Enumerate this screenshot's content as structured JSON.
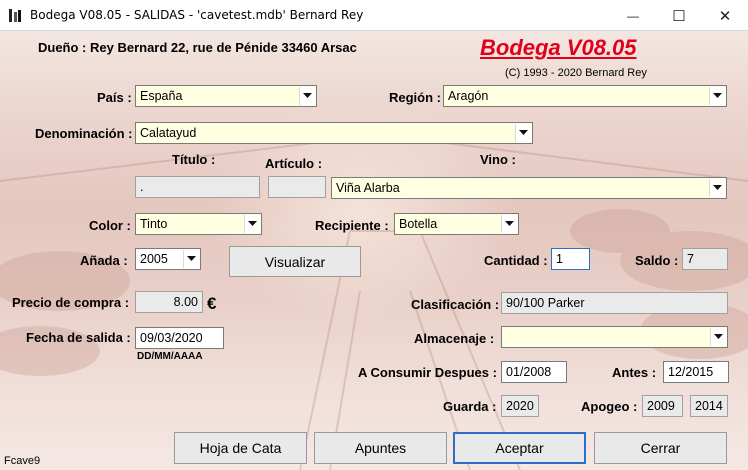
{
  "window": {
    "title": "Bodega V08.05  - SALIDAS -  'cavetest.mdb'   Bernard Rey",
    "minimize_glyph": "—",
    "maximize_glyph": "☐",
    "close_glyph": "✕"
  },
  "header": {
    "owner": "Dueño : Rey Bernard 22, rue de Pénide 33460 Arsac",
    "brand": "Bodega V08.05",
    "copyright": "(C) 1993 - 2020 Bernard Rey"
  },
  "form": {
    "pais": {
      "label": "País :",
      "value": "España"
    },
    "region": {
      "label": "Región :",
      "value": "Aragón"
    },
    "denominacion": {
      "label": "Denominación :",
      "value": "Calatayud"
    },
    "titulo": {
      "label": "Título :",
      "value": "."
    },
    "articulo": {
      "label": "Artículo :",
      "value": ""
    },
    "vino": {
      "label": "Vino :",
      "value": "Viña Alarba"
    },
    "color": {
      "label": "Color :",
      "value": "Tinto"
    },
    "recipiente": {
      "label": "Recipiente :",
      "value": "Botella"
    },
    "anada": {
      "label": "Añada :",
      "value": "2005"
    },
    "visualizar_label": "Visualizar",
    "cantidad": {
      "label": "Cantidad :",
      "value": "1"
    },
    "saldo": {
      "label": "Saldo :",
      "value": "7"
    },
    "precio": {
      "label": "Precio de compra :",
      "value": "8.00",
      "currency": "€"
    },
    "clasificacion": {
      "label": "Clasificación :",
      "value": "90/100 Parker"
    },
    "fecha_salida": {
      "label": "Fecha de salida :",
      "value": "09/03/2020",
      "format_hint": "DD/MM/AAAA"
    },
    "almacenaje": {
      "label": "Almacenaje :",
      "value": ""
    },
    "consumir_despues": {
      "label": "A Consumir Despues :",
      "value": "01/2008"
    },
    "antes": {
      "label": "Antes :",
      "value": "12/2015"
    },
    "guarda": {
      "label": "Guarda :",
      "value": "2020"
    },
    "apogeo": {
      "label": "Apogeo :",
      "from": "2009",
      "to": "2014"
    }
  },
  "buttons": {
    "hoja_cata": "Hoja de Cata",
    "apuntes": "Apuntes",
    "aceptar": "Aceptar",
    "cerrar": "Cerrar"
  },
  "status": {
    "form_id": "Fcave9"
  },
  "colors": {
    "brand": "#e0001a",
    "field_bg": "#ffffe1",
    "accent": "#2d6fc7"
  }
}
